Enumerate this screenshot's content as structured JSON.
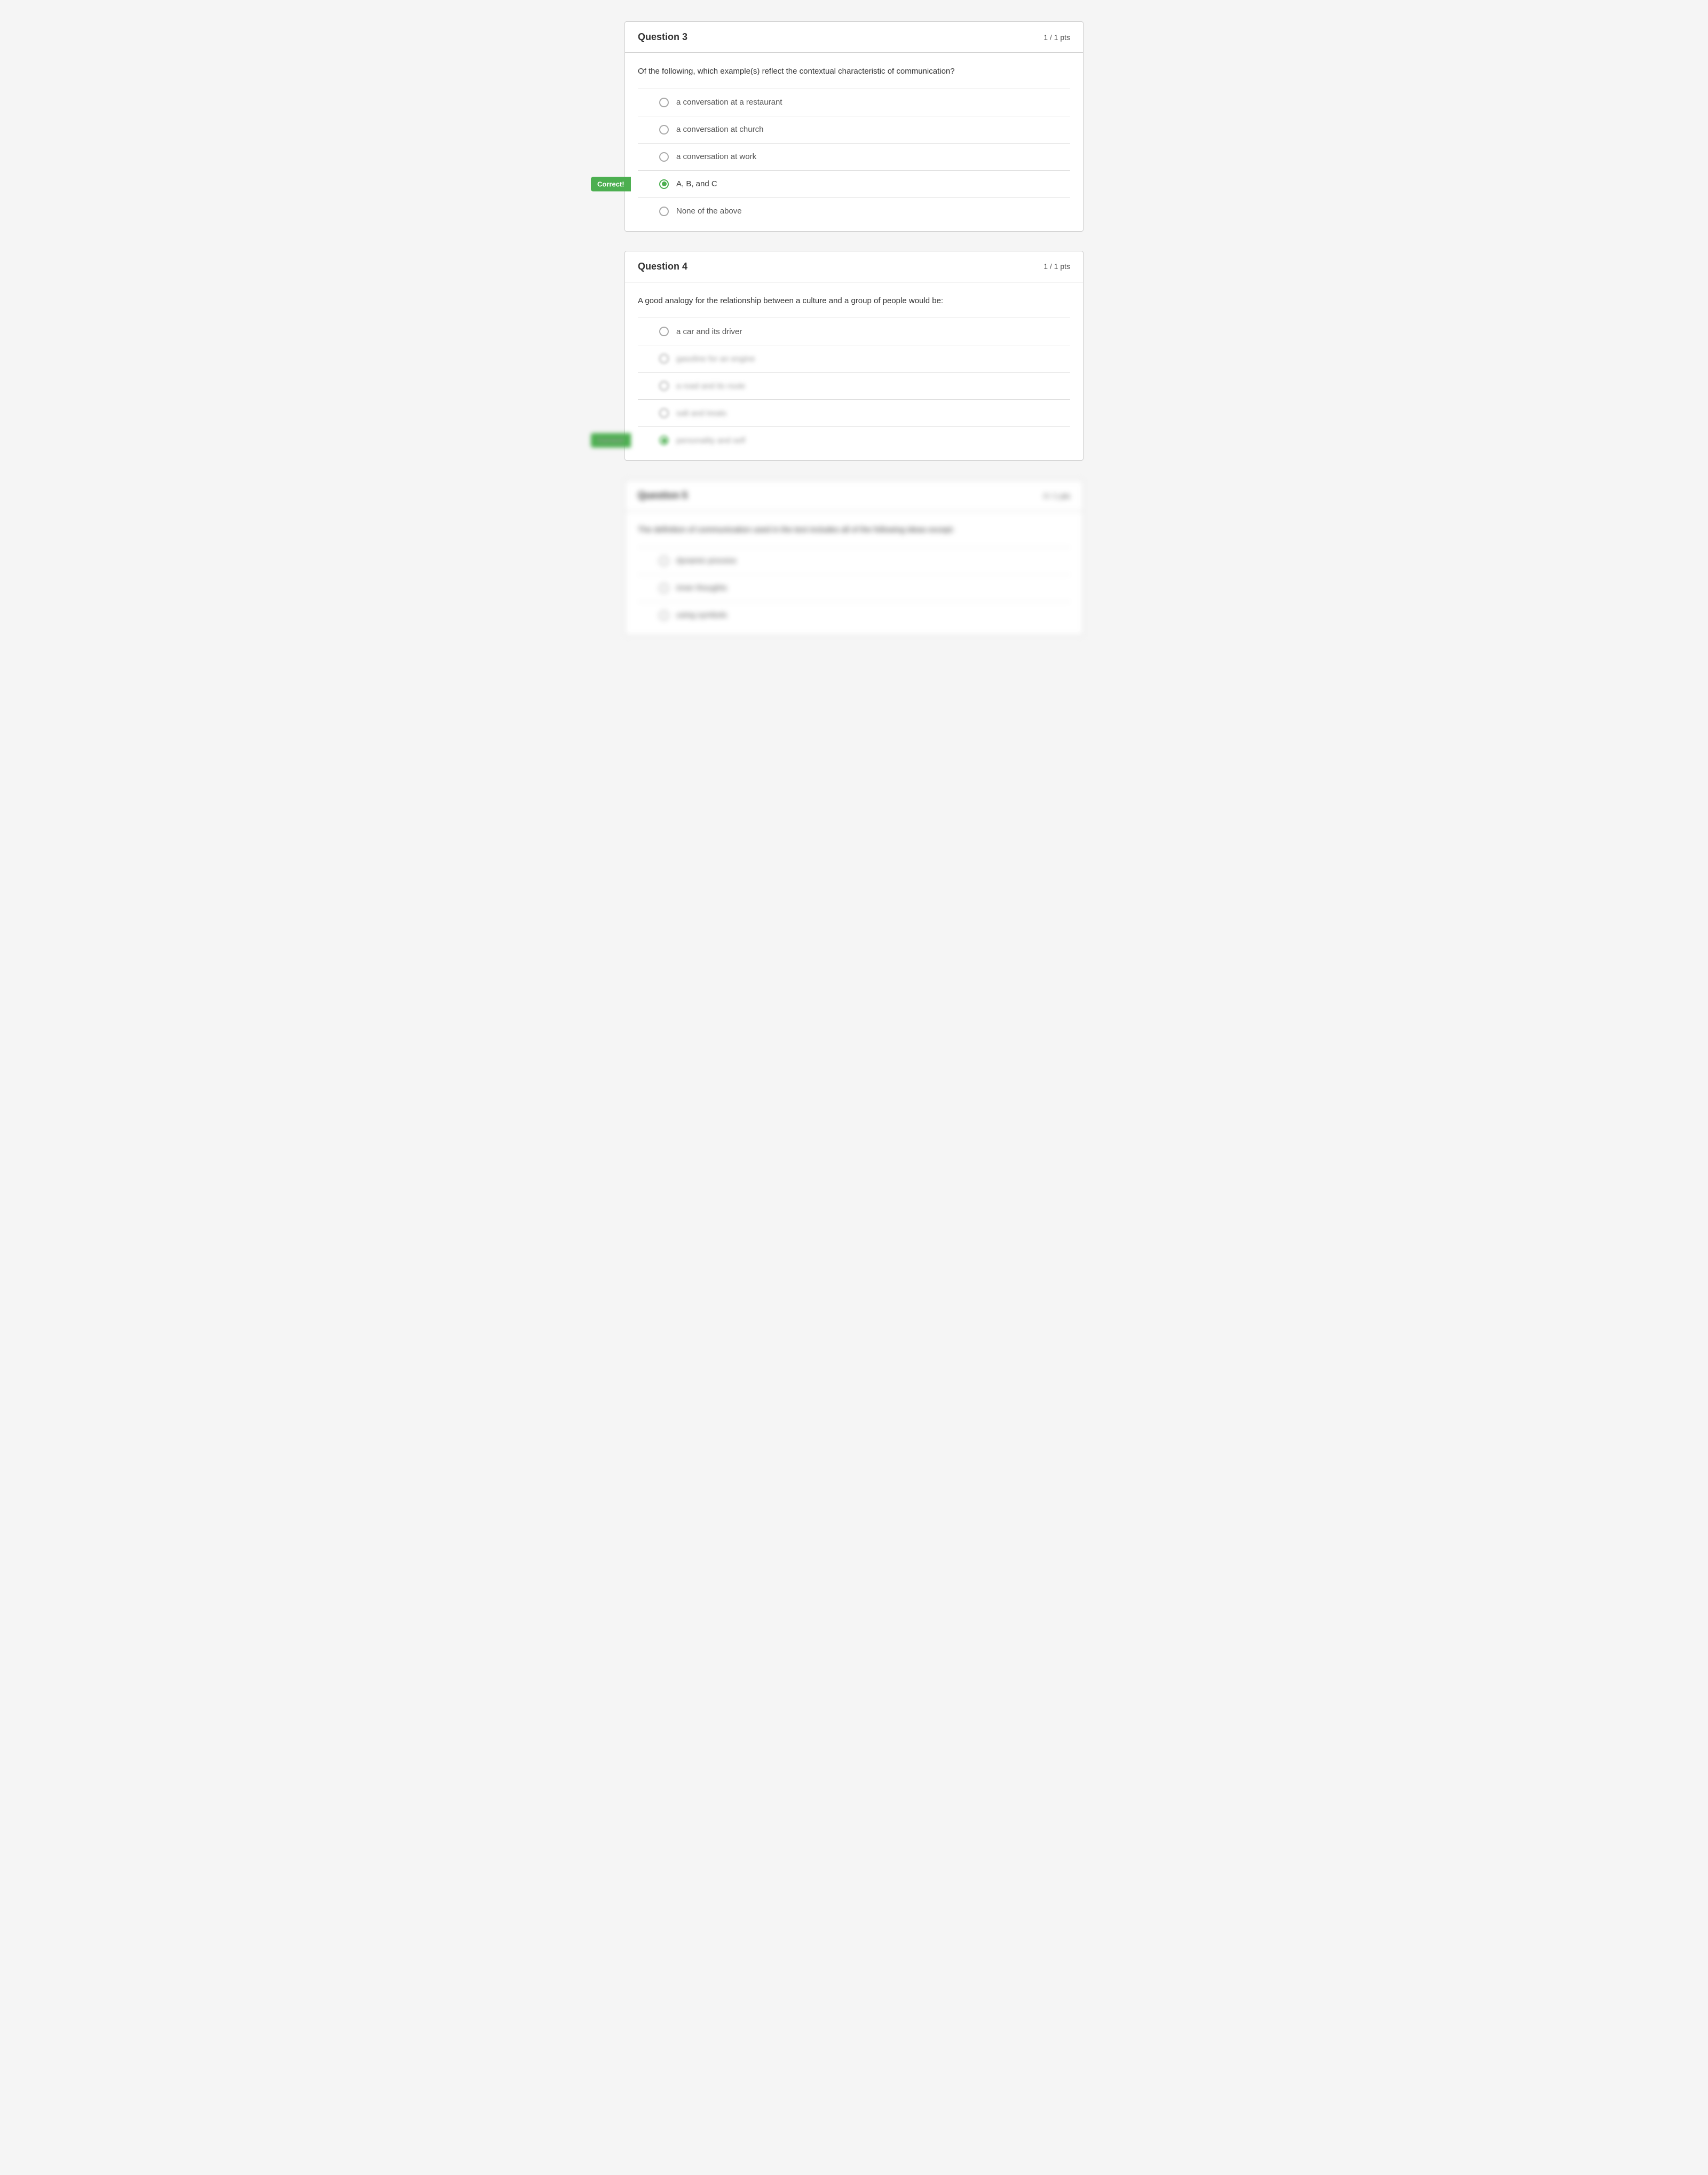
{
  "question3": {
    "title": "Question 3",
    "pts": "1 / 1 pts",
    "question_text": "Of the following, which example(s) reflect the contextual characteristic of communication?",
    "options": [
      {
        "id": "q3_a",
        "label": "a conversation at a restaurant",
        "selected": false
      },
      {
        "id": "q3_b",
        "label": "a conversation at church",
        "selected": false
      },
      {
        "id": "q3_c",
        "label": "a conversation at work",
        "selected": false
      },
      {
        "id": "q3_d",
        "label": "A, B, and C",
        "selected": true,
        "correct": true
      },
      {
        "id": "q3_e",
        "label": "None of the above",
        "selected": false
      }
    ],
    "correct_badge": "Correct!"
  },
  "question4": {
    "title": "Question 4",
    "pts": "1 / 1 pts",
    "question_text": "A good analogy for the relationship between a culture and a group of people would be:",
    "options": [
      {
        "id": "q4_a",
        "label": "a car and its driver",
        "selected": false,
        "blurred": false
      },
      {
        "id": "q4_b",
        "label": "gasoline for an engine",
        "selected": false,
        "blurred": true
      },
      {
        "id": "q4_c",
        "label": "a road and its route",
        "selected": false,
        "blurred": true
      },
      {
        "id": "q4_d",
        "label": "salt and treats",
        "selected": false,
        "blurred": true
      },
      {
        "id": "q4_e",
        "label": "personality and self",
        "selected": true,
        "blurred": true,
        "correct": true
      }
    ],
    "correct_badge": "Correct!"
  },
  "question5": {
    "title": "Question 5",
    "pts": "0 / 1 pts",
    "question_text": "The definition of communication used in the text includes all of the following ideas except:",
    "options": [
      {
        "id": "q5_a",
        "label": "dynamic process",
        "selected": false
      },
      {
        "id": "q5_b",
        "label": "inner thoughts",
        "selected": false
      },
      {
        "id": "q5_c",
        "label": "using symbols",
        "selected": false
      }
    ]
  }
}
